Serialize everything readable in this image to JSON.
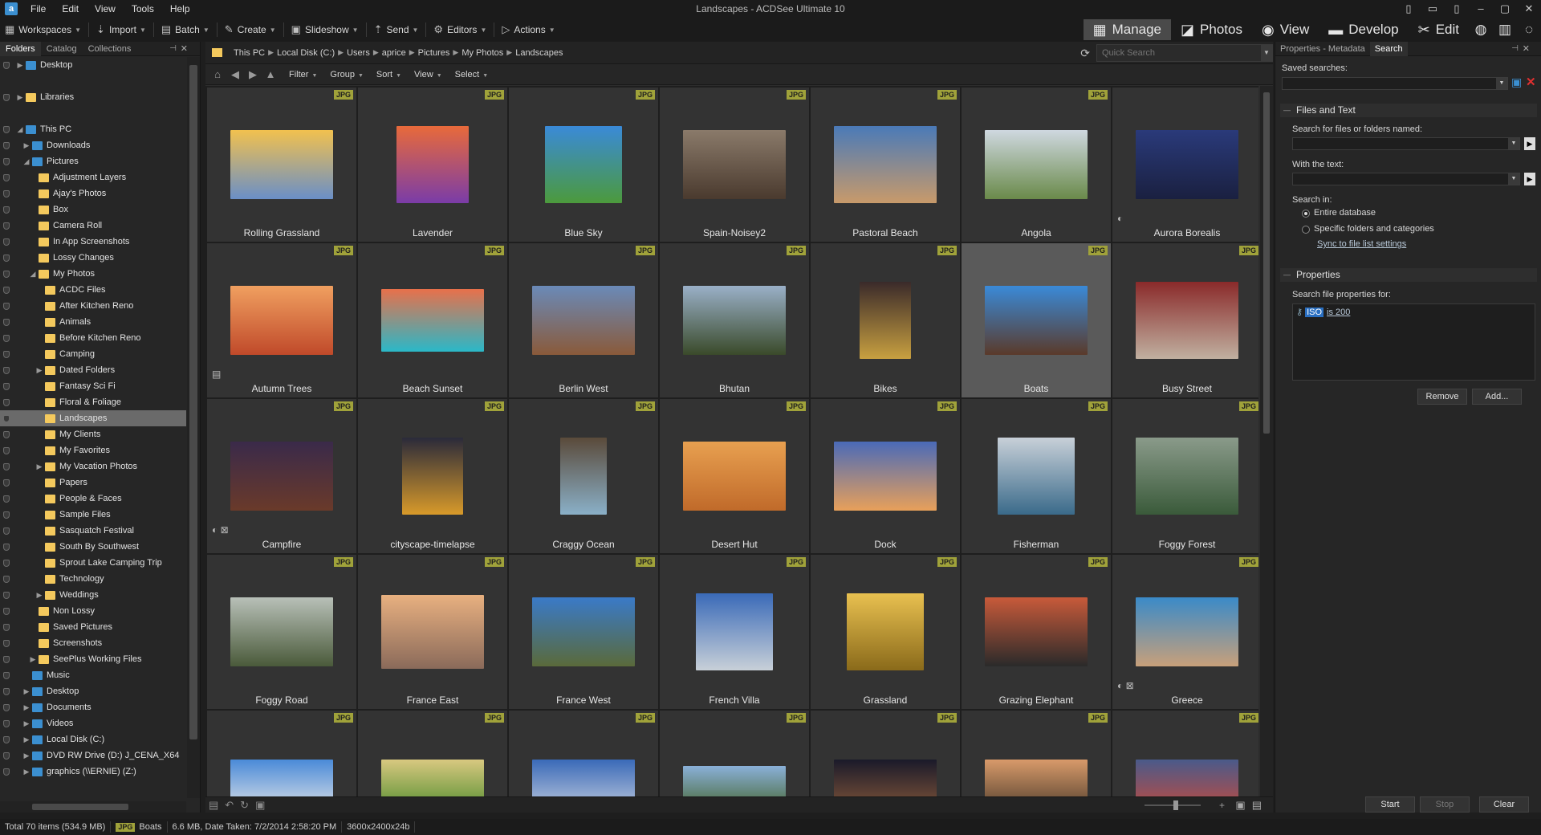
{
  "window": {
    "title": "Landscapes - ACDSee Ultimate 10"
  },
  "menu": [
    "File",
    "Edit",
    "View",
    "Tools",
    "Help"
  ],
  "toolbar": {
    "items": [
      {
        "label": "Workspaces",
        "icon": "workspaces-icon",
        "glyph": "▦"
      },
      {
        "label": "Import",
        "icon": "import-icon",
        "glyph": "⇣"
      },
      {
        "label": "Batch",
        "icon": "batch-icon",
        "glyph": "▤"
      },
      {
        "label": "Create",
        "icon": "create-icon",
        "glyph": "✎"
      },
      {
        "label": "Slideshow",
        "icon": "slideshow-icon",
        "glyph": "▣"
      },
      {
        "label": "Send",
        "icon": "send-icon",
        "glyph": "⇡"
      },
      {
        "label": "Editors",
        "icon": "editors-icon",
        "glyph": "⚙"
      },
      {
        "label": "Actions",
        "icon": "actions-icon",
        "glyph": "▷"
      }
    ]
  },
  "modes": [
    {
      "label": "Manage",
      "icon": "manage-icon",
      "glyph": "▦",
      "active": true
    },
    {
      "label": "Photos",
      "icon": "photos-icon",
      "glyph": "◪"
    },
    {
      "label": "View",
      "icon": "view-eye-icon",
      "glyph": "◉"
    },
    {
      "label": "Develop",
      "icon": "develop-icon",
      "glyph": "▬"
    },
    {
      "label": "Edit",
      "icon": "edit-icon",
      "glyph": "✂"
    }
  ],
  "mode_extras": [
    {
      "icon": "360-icon",
      "glyph": "◍"
    },
    {
      "icon": "dashboard-icon",
      "glyph": "▥"
    },
    {
      "icon": "online-icon",
      "glyph": "◌"
    }
  ],
  "left_pane": {
    "tabs": [
      "Folders",
      "Catalog",
      "Collections"
    ],
    "tree": [
      {
        "label": "Desktop",
        "depth": 0,
        "arrow": "▶",
        "icon": "blue"
      },
      {
        "label": "",
        "depth": 0,
        "spacer": true
      },
      {
        "label": "Libraries",
        "depth": 0,
        "arrow": "▶",
        "icon": "yellow"
      },
      {
        "label": "",
        "depth": 0,
        "spacer": true
      },
      {
        "label": "This PC",
        "depth": 0,
        "arrow": "◢",
        "icon": "blue"
      },
      {
        "label": "Downloads",
        "depth": 1,
        "arrow": "▶",
        "icon": "blue"
      },
      {
        "label": "Pictures",
        "depth": 1,
        "arrow": "◢",
        "icon": "blue"
      },
      {
        "label": "Adjustment Layers",
        "depth": 2,
        "icon": "yellow"
      },
      {
        "label": "Ajay's Photos",
        "depth": 2,
        "icon": "yellow"
      },
      {
        "label": "Box",
        "depth": 2,
        "icon": "yellow"
      },
      {
        "label": "Camera Roll",
        "depth": 2,
        "icon": "yellow"
      },
      {
        "label": "In App Screenshots",
        "depth": 2,
        "icon": "yellow"
      },
      {
        "label": "Lossy Changes",
        "depth": 2,
        "icon": "yellow"
      },
      {
        "label": "My Photos",
        "depth": 2,
        "arrow": "◢",
        "icon": "yellow"
      },
      {
        "label": "ACDC Files",
        "depth": 3,
        "icon": "yellow"
      },
      {
        "label": "After Kitchen Reno",
        "depth": 3,
        "icon": "yellow"
      },
      {
        "label": "Animals",
        "depth": 3,
        "icon": "yellow"
      },
      {
        "label": "Before Kitchen Reno",
        "depth": 3,
        "icon": "yellow"
      },
      {
        "label": "Camping",
        "depth": 3,
        "icon": "yellow"
      },
      {
        "label": "Dated Folders",
        "depth": 3,
        "arrow": "▶",
        "icon": "yellow"
      },
      {
        "label": "Fantasy Sci Fi",
        "depth": 3,
        "icon": "yellow"
      },
      {
        "label": "Floral & Foliage",
        "depth": 3,
        "icon": "yellow"
      },
      {
        "label": "Landscapes",
        "depth": 3,
        "icon": "yellow",
        "selected": true
      },
      {
        "label": "My Clients",
        "depth": 3,
        "icon": "yellow"
      },
      {
        "label": "My Favorites",
        "depth": 3,
        "icon": "yellow"
      },
      {
        "label": "My Vacation Photos",
        "depth": 3,
        "arrow": "▶",
        "icon": "yellow"
      },
      {
        "label": "Papers",
        "depth": 3,
        "icon": "yellow"
      },
      {
        "label": "People & Faces",
        "depth": 3,
        "icon": "yellow"
      },
      {
        "label": "Sample Files",
        "depth": 3,
        "icon": "yellow"
      },
      {
        "label": "Sasquatch Festival",
        "depth": 3,
        "icon": "yellow"
      },
      {
        "label": "South By Southwest",
        "depth": 3,
        "icon": "yellow"
      },
      {
        "label": "Sprout Lake Camping Trip",
        "depth": 3,
        "icon": "yellow"
      },
      {
        "label": "Technology",
        "depth": 3,
        "icon": "yellow"
      },
      {
        "label": "Weddings",
        "depth": 3,
        "arrow": "▶",
        "icon": "yellow"
      },
      {
        "label": "Non Lossy",
        "depth": 2,
        "icon": "yellow"
      },
      {
        "label": "Saved Pictures",
        "depth": 2,
        "icon": "yellow"
      },
      {
        "label": "Screenshots",
        "depth": 2,
        "icon": "yellow"
      },
      {
        "label": "SeePlus Working Files",
        "depth": 2,
        "arrow": "▶",
        "icon": "yellow"
      },
      {
        "label": "Music",
        "depth": 1,
        "icon": "blue"
      },
      {
        "label": "Desktop",
        "depth": 1,
        "arrow": "▶",
        "icon": "blue"
      },
      {
        "label": "Documents",
        "depth": 1,
        "arrow": "▶",
        "icon": "blue"
      },
      {
        "label": "Videos",
        "depth": 1,
        "arrow": "▶",
        "icon": "blue"
      },
      {
        "label": "Local Disk (C:)",
        "depth": 1,
        "arrow": "▶",
        "icon": "blue"
      },
      {
        "label": "DVD RW Drive (D:) J_CENA_X64",
        "depth": 1,
        "arrow": "▶",
        "icon": "blue"
      },
      {
        "label": "graphics (\\\\ERNIE) (Z:)",
        "depth": 1,
        "arrow": "▶",
        "icon": "blue"
      }
    ]
  },
  "address": {
    "crumbs": [
      "This PC",
      "Local Disk (C:)",
      "Users",
      "aprice",
      "Pictures",
      "My Photos",
      "Landscapes"
    ],
    "quick_search_placeholder": "Quick Search"
  },
  "filterbar": [
    "Filter",
    "Group",
    "Sort",
    "View",
    "Select"
  ],
  "files": [
    {
      "name": "Rolling Grassland",
      "ext": "JPG",
      "c1": "#f2c14e",
      "c2": "#6a8fc7",
      "w": 128,
      "h": 86
    },
    {
      "name": "Lavender",
      "ext": "JPG",
      "c1": "#e86a3a",
      "c2": "#7a3ca8",
      "w": 90,
      "h": 96
    },
    {
      "name": "Blue Sky",
      "ext": "JPG",
      "c1": "#3a8ad8",
      "c2": "#4c9a3c",
      "w": 96,
      "h": 96
    },
    {
      "name": "Spain-Noisey2",
      "ext": "JPG",
      "c1": "#8a7a6a",
      "c2": "#4a3a2e",
      "w": 128,
      "h": 86
    },
    {
      "name": "Pastoral Beach",
      "ext": "JPG",
      "c1": "#4a7ab8",
      "c2": "#c89a6a",
      "w": 128,
      "h": 96
    },
    {
      "name": "Angola",
      "ext": "JPG",
      "c1": "#cfd8e0",
      "c2": "#6a8a4a",
      "w": 128,
      "h": 86
    },
    {
      "name": "Aurora Borealis",
      "ext": "",
      "c1": "#2a3a7a",
      "c2": "#1a2040",
      "w": 128,
      "h": 86,
      "meta": "◐"
    },
    {
      "name": "Autumn Trees",
      "ext": "JPG",
      "c1": "#f0a060",
      "c2": "#c04a2a",
      "w": 128,
      "h": 86,
      "meta": "▤"
    },
    {
      "name": "Beach Sunset",
      "ext": "JPG",
      "c1": "#e8704a",
      "c2": "#2ab8c8",
      "w": 128,
      "h": 78
    },
    {
      "name": "Berlin West",
      "ext": "JPG",
      "c1": "#6a8ab8",
      "c2": "#8a5a3a",
      "w": 128,
      "h": 86
    },
    {
      "name": "Bhutan",
      "ext": "JPG",
      "c1": "#9ab0c8",
      "c2": "#3a4a2a",
      "w": 128,
      "h": 86
    },
    {
      "name": "Bikes",
      "ext": "JPG",
      "c1": "#3a2a2a",
      "c2": "#c8a040",
      "w": 64,
      "h": 96
    },
    {
      "name": "Boats",
      "ext": "JPG",
      "c1": "#3a8ad8",
      "c2": "#5a3a2a",
      "w": 128,
      "h": 86,
      "selected": true
    },
    {
      "name": "Busy Street",
      "ext": "JPG",
      "c1": "#8a2a2a",
      "c2": "#c0b0a0",
      "w": 128,
      "h": 96
    },
    {
      "name": "Campfire",
      "ext": "JPG",
      "c1": "#3a2a4a",
      "c2": "#6a3a2a",
      "w": 128,
      "h": 86,
      "meta": "◐ ⊠"
    },
    {
      "name": "cityscape-timelapse",
      "ext": "JPG",
      "c1": "#2a2a3a",
      "c2": "#d89a2a",
      "w": 76,
      "h": 96
    },
    {
      "name": "Craggy Ocean",
      "ext": "JPG",
      "c1": "#5a4a3a",
      "c2": "#8ab0c8",
      "w": 58,
      "h": 96
    },
    {
      "name": "Desert Hut",
      "ext": "JPG",
      "c1": "#e8a050",
      "c2": "#c06a2a",
      "w": 128,
      "h": 86
    },
    {
      "name": "Dock",
      "ext": "JPG",
      "c1": "#4a6ab8",
      "c2": "#e8a05a",
      "w": 128,
      "h": 86
    },
    {
      "name": "Fisherman",
      "ext": "JPG",
      "c1": "#c8d0d8",
      "c2": "#3a6a8a",
      "w": 96,
      "h": 96
    },
    {
      "name": "Foggy Forest",
      "ext": "JPG",
      "c1": "#8a9a8a",
      "c2": "#3a5a3a",
      "w": 128,
      "h": 96
    },
    {
      "name": "Foggy Road",
      "ext": "JPG",
      "c1": "#b8c0b8",
      "c2": "#4a5a3a",
      "w": 128,
      "h": 86
    },
    {
      "name": "France East",
      "ext": "JPG",
      "c1": "#e8b080",
      "c2": "#8a6a5a",
      "w": 128,
      "h": 92
    },
    {
      "name": "France West",
      "ext": "JPG",
      "c1": "#3a7ac8",
      "c2": "#5a6a3a",
      "w": 128,
      "h": 86
    },
    {
      "name": "French Villa",
      "ext": "JPG",
      "c1": "#3a6ab8",
      "c2": "#c8d0d8",
      "w": 96,
      "h": 96
    },
    {
      "name": "Grassland",
      "ext": "JPG",
      "c1": "#e8c050",
      "c2": "#8a6a1a",
      "w": 96,
      "h": 96
    },
    {
      "name": "Grazing Elephant",
      "ext": "JPG",
      "c1": "#c85a3a",
      "c2": "#2a2a2a",
      "w": 128,
      "h": 86
    },
    {
      "name": "Greece",
      "ext": "JPG",
      "c1": "#3a8ac8",
      "c2": "#c8a07a",
      "w": 128,
      "h": 86,
      "meta": "◐ ⊠"
    },
    {
      "name": "",
      "ext": "JPG",
      "c1": "#4a8ad8",
      "c2": "#e8e8e8",
      "w": 128,
      "h": 70
    },
    {
      "name": "",
      "ext": "JPG",
      "c1": "#d8c880",
      "c2": "#4a8a2a",
      "w": 128,
      "h": 70
    },
    {
      "name": "",
      "ext": "JPG",
      "c1": "#3a6ab8",
      "c2": "#c8d0e0",
      "w": 128,
      "h": 70
    },
    {
      "name": "",
      "ext": "JPG",
      "c1": "#8ab0d8",
      "c2": "#4a6a3a",
      "w": 128,
      "h": 54
    },
    {
      "name": "",
      "ext": "JPG",
      "c1": "#1a1a2a",
      "c2": "#8a5a3a",
      "w": 128,
      "h": 70
    },
    {
      "name": "",
      "ext": "JPG",
      "c1": "#d89a6a",
      "c2": "#4a3a2a",
      "w": 128,
      "h": 70
    },
    {
      "name": "",
      "ext": "JPG",
      "c1": "#4a5a8a",
      "c2": "#c84a3a",
      "w": 128,
      "h": 70
    }
  ],
  "right_pane": {
    "tabs": [
      "Properties - Metadata",
      "Search"
    ],
    "saved_searches_label": "Saved searches:",
    "files_and_text_header": "Files and Text",
    "search_named_label": "Search for files or folders named:",
    "with_text_label": "With the text:",
    "search_in_label": "Search in:",
    "radio_entire": "Entire database",
    "radio_specific": "Specific folders and categories",
    "sync_link": "Sync to file list settings",
    "properties_header": "Properties",
    "search_props_label": "Search file properties for:",
    "prop_field": "ISO",
    "prop_value": "is 200",
    "remove_btn": "Remove",
    "add_btn": "Add...",
    "start_btn": "Start",
    "stop_btn": "Stop",
    "clear_btn": "Clear"
  },
  "status": {
    "total": "Total 70 items  (534.9 MB)",
    "type": "JPG",
    "selected": "Boats",
    "details": "6.6 MB, Date Taken: 7/2/2014 2:58:20 PM",
    "dims": "3600x2400x24b"
  },
  "colors": {
    "accent": "#2a6fc1",
    "badge": "#a0a23a",
    "folder": "#f4c95d"
  }
}
